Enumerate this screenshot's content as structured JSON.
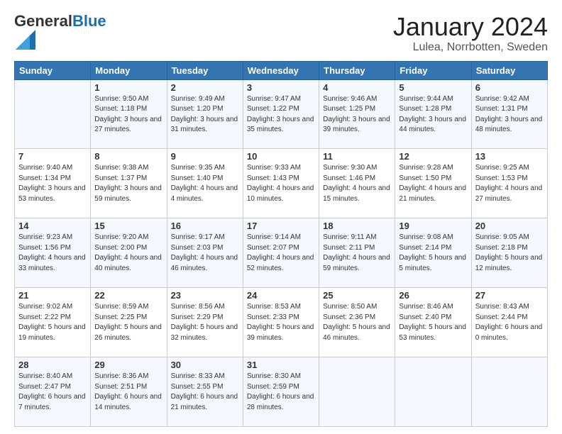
{
  "header": {
    "logo_general": "General",
    "logo_blue": "Blue",
    "title": "January 2024",
    "subtitle": "Lulea, Norrbotten, Sweden"
  },
  "weekdays": [
    "Sunday",
    "Monday",
    "Tuesday",
    "Wednesday",
    "Thursday",
    "Friday",
    "Saturday"
  ],
  "weeks": [
    [
      {
        "day": "",
        "sunrise": "",
        "sunset": "",
        "daylight": ""
      },
      {
        "day": "1",
        "sunrise": "Sunrise: 9:50 AM",
        "sunset": "Sunset: 1:18 PM",
        "daylight": "Daylight: 3 hours and 27 minutes."
      },
      {
        "day": "2",
        "sunrise": "Sunrise: 9:49 AM",
        "sunset": "Sunset: 1:20 PM",
        "daylight": "Daylight: 3 hours and 31 minutes."
      },
      {
        "day": "3",
        "sunrise": "Sunrise: 9:47 AM",
        "sunset": "Sunset: 1:22 PM",
        "daylight": "Daylight: 3 hours and 35 minutes."
      },
      {
        "day": "4",
        "sunrise": "Sunrise: 9:46 AM",
        "sunset": "Sunset: 1:25 PM",
        "daylight": "Daylight: 3 hours and 39 minutes."
      },
      {
        "day": "5",
        "sunrise": "Sunrise: 9:44 AM",
        "sunset": "Sunset: 1:28 PM",
        "daylight": "Daylight: 3 hours and 44 minutes."
      },
      {
        "day": "6",
        "sunrise": "Sunrise: 9:42 AM",
        "sunset": "Sunset: 1:31 PM",
        "daylight": "Daylight: 3 hours and 48 minutes."
      }
    ],
    [
      {
        "day": "7",
        "sunrise": "Sunrise: 9:40 AM",
        "sunset": "Sunset: 1:34 PM",
        "daylight": "Daylight: 3 hours and 53 minutes."
      },
      {
        "day": "8",
        "sunrise": "Sunrise: 9:38 AM",
        "sunset": "Sunset: 1:37 PM",
        "daylight": "Daylight: 3 hours and 59 minutes."
      },
      {
        "day": "9",
        "sunrise": "Sunrise: 9:35 AM",
        "sunset": "Sunset: 1:40 PM",
        "daylight": "Daylight: 4 hours and 4 minutes."
      },
      {
        "day": "10",
        "sunrise": "Sunrise: 9:33 AM",
        "sunset": "Sunset: 1:43 PM",
        "daylight": "Daylight: 4 hours and 10 minutes."
      },
      {
        "day": "11",
        "sunrise": "Sunrise: 9:30 AM",
        "sunset": "Sunset: 1:46 PM",
        "daylight": "Daylight: 4 hours and 15 minutes."
      },
      {
        "day": "12",
        "sunrise": "Sunrise: 9:28 AM",
        "sunset": "Sunset: 1:50 PM",
        "daylight": "Daylight: 4 hours and 21 minutes."
      },
      {
        "day": "13",
        "sunrise": "Sunrise: 9:25 AM",
        "sunset": "Sunset: 1:53 PM",
        "daylight": "Daylight: 4 hours and 27 minutes."
      }
    ],
    [
      {
        "day": "14",
        "sunrise": "Sunrise: 9:23 AM",
        "sunset": "Sunset: 1:56 PM",
        "daylight": "Daylight: 4 hours and 33 minutes."
      },
      {
        "day": "15",
        "sunrise": "Sunrise: 9:20 AM",
        "sunset": "Sunset: 2:00 PM",
        "daylight": "Daylight: 4 hours and 40 minutes."
      },
      {
        "day": "16",
        "sunrise": "Sunrise: 9:17 AM",
        "sunset": "Sunset: 2:03 PM",
        "daylight": "Daylight: 4 hours and 46 minutes."
      },
      {
        "day": "17",
        "sunrise": "Sunrise: 9:14 AM",
        "sunset": "Sunset: 2:07 PM",
        "daylight": "Daylight: 4 hours and 52 minutes."
      },
      {
        "day": "18",
        "sunrise": "Sunrise: 9:11 AM",
        "sunset": "Sunset: 2:11 PM",
        "daylight": "Daylight: 4 hours and 59 minutes."
      },
      {
        "day": "19",
        "sunrise": "Sunrise: 9:08 AM",
        "sunset": "Sunset: 2:14 PM",
        "daylight": "Daylight: 5 hours and 5 minutes."
      },
      {
        "day": "20",
        "sunrise": "Sunrise: 9:05 AM",
        "sunset": "Sunset: 2:18 PM",
        "daylight": "Daylight: 5 hours and 12 minutes."
      }
    ],
    [
      {
        "day": "21",
        "sunrise": "Sunrise: 9:02 AM",
        "sunset": "Sunset: 2:22 PM",
        "daylight": "Daylight: 5 hours and 19 minutes."
      },
      {
        "day": "22",
        "sunrise": "Sunrise: 8:59 AM",
        "sunset": "Sunset: 2:25 PM",
        "daylight": "Daylight: 5 hours and 26 minutes."
      },
      {
        "day": "23",
        "sunrise": "Sunrise: 8:56 AM",
        "sunset": "Sunset: 2:29 PM",
        "daylight": "Daylight: 5 hours and 32 minutes."
      },
      {
        "day": "24",
        "sunrise": "Sunrise: 8:53 AM",
        "sunset": "Sunset: 2:33 PM",
        "daylight": "Daylight: 5 hours and 39 minutes."
      },
      {
        "day": "25",
        "sunrise": "Sunrise: 8:50 AM",
        "sunset": "Sunset: 2:36 PM",
        "daylight": "Daylight: 5 hours and 46 minutes."
      },
      {
        "day": "26",
        "sunrise": "Sunrise: 8:46 AM",
        "sunset": "Sunset: 2:40 PM",
        "daylight": "Daylight: 5 hours and 53 minutes."
      },
      {
        "day": "27",
        "sunrise": "Sunrise: 8:43 AM",
        "sunset": "Sunset: 2:44 PM",
        "daylight": "Daylight: 6 hours and 0 minutes."
      }
    ],
    [
      {
        "day": "28",
        "sunrise": "Sunrise: 8:40 AM",
        "sunset": "Sunset: 2:47 PM",
        "daylight": "Daylight: 6 hours and 7 minutes."
      },
      {
        "day": "29",
        "sunrise": "Sunrise: 8:36 AM",
        "sunset": "Sunset: 2:51 PM",
        "daylight": "Daylight: 6 hours and 14 minutes."
      },
      {
        "day": "30",
        "sunrise": "Sunrise: 8:33 AM",
        "sunset": "Sunset: 2:55 PM",
        "daylight": "Daylight: 6 hours and 21 minutes."
      },
      {
        "day": "31",
        "sunrise": "Sunrise: 8:30 AM",
        "sunset": "Sunset: 2:59 PM",
        "daylight": "Daylight: 6 hours and 28 minutes."
      },
      {
        "day": "",
        "sunrise": "",
        "sunset": "",
        "daylight": ""
      },
      {
        "day": "",
        "sunrise": "",
        "sunset": "",
        "daylight": ""
      },
      {
        "day": "",
        "sunrise": "",
        "sunset": "",
        "daylight": ""
      }
    ]
  ]
}
